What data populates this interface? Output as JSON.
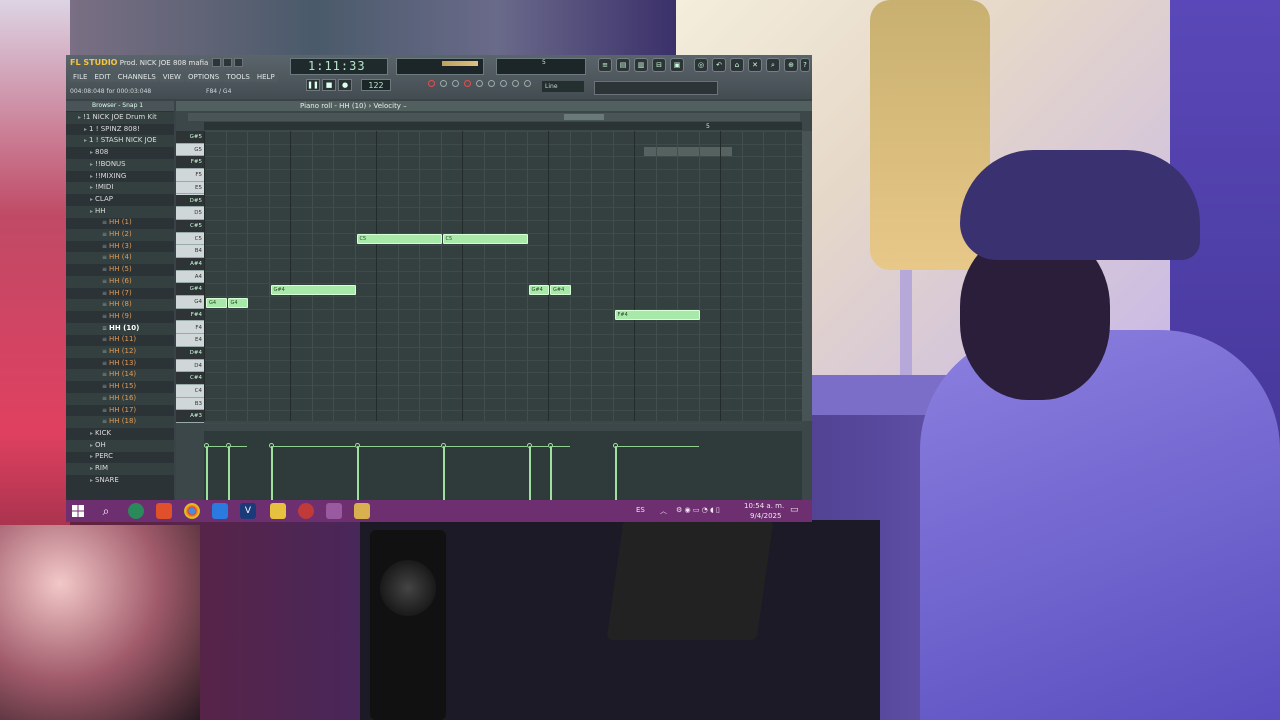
{
  "fl": {
    "title": "Prod. NICK JOE  808 mafia Beat..",
    "logo": "FL STUDIO",
    "menu": [
      "FILE",
      "EDIT",
      "CHANNELS",
      "VIEW",
      "OPTIONS",
      "TOOLS",
      "HELP"
    ],
    "hint_time": "004:08:048 for 000:03:048",
    "hint_right": "F84 / G4",
    "transport_time": "1:11:33",
    "bpm": "122",
    "cpu_label": "5",
    "line_select": "Line",
    "browser_title": "Browser - Snap 1",
    "piano_roll_title": "Piano roll - HH (10) › Velocity –",
    "ruler_number": "5"
  },
  "browser": {
    "items": [
      {
        "label": "!1 NICK JOE Drum Kit",
        "type": "folder"
      },
      {
        "label": "1 ! SPINZ 808!",
        "type": "folder"
      },
      {
        "label": "1 ! STASH NICK JOE",
        "type": "folder"
      },
      {
        "label": "808",
        "type": "folder"
      },
      {
        "label": "!!BONUS",
        "type": "folder"
      },
      {
        "label": "!!MIXING",
        "type": "folder"
      },
      {
        "label": "!MIDI",
        "type": "folder"
      },
      {
        "label": "CLAP",
        "type": "folder"
      },
      {
        "label": "HH",
        "type": "folder"
      },
      {
        "label": "HH (1)",
        "type": "sample"
      },
      {
        "label": "HH (2)",
        "type": "sample"
      },
      {
        "label": "HH (3)",
        "type": "sample"
      },
      {
        "label": "HH (4)",
        "type": "sample"
      },
      {
        "label": "HH (5)",
        "type": "sample"
      },
      {
        "label": "HH (6)",
        "type": "sample"
      },
      {
        "label": "HH (7)",
        "type": "sample"
      },
      {
        "label": "HH (8)",
        "type": "sample"
      },
      {
        "label": "HH (9)",
        "type": "sample"
      },
      {
        "label": "HH (10)",
        "type": "selected"
      },
      {
        "label": "HH (11)",
        "type": "sample"
      },
      {
        "label": "HH (12)",
        "type": "sample"
      },
      {
        "label": "HH (13)",
        "type": "sample"
      },
      {
        "label": "HH (14)",
        "type": "sample"
      },
      {
        "label": "HH (15)",
        "type": "sample"
      },
      {
        "label": "HH (16)",
        "type": "sample"
      },
      {
        "label": "HH (17)",
        "type": "sample"
      },
      {
        "label": "HH (18)",
        "type": "sample"
      },
      {
        "label": "KICK",
        "type": "folder"
      },
      {
        "label": "OH",
        "type": "folder"
      },
      {
        "label": "PERC",
        "type": "folder"
      },
      {
        "label": "RIM",
        "type": "folder"
      },
      {
        "label": "SNARE",
        "type": "folder"
      }
    ]
  },
  "piano_keys": [
    "G#5",
    "G5",
    "F#5",
    "F5",
    "E5",
    "D#5",
    "D5",
    "C#5",
    "C5",
    "B4",
    "A#4",
    "A4",
    "G#4",
    "G4",
    "F#4",
    "F4",
    "E4",
    "D#4",
    "D4",
    "C#4",
    "C4",
    "B3",
    "A#3"
  ],
  "notes": [
    {
      "label": "C5",
      "key": "C5",
      "start": 7,
      "len": 4
    },
    {
      "label": "C5",
      "key": "C5",
      "start": 11,
      "len": 4
    },
    {
      "label": "G#4",
      "key": "G#4",
      "start": 3,
      "len": 4
    },
    {
      "label": "G#4",
      "key": "G#4",
      "start": 15,
      "len": 1
    },
    {
      "label": "G#4",
      "key": "G#4",
      "start": 16,
      "len": 1
    },
    {
      "label": "G4",
      "key": "G4",
      "start": 0,
      "len": 1
    },
    {
      "label": "G4",
      "key": "G4",
      "start": 1,
      "len": 1
    },
    {
      "label": "F#4",
      "key": "F#4",
      "start": 19,
      "len": 4
    }
  ],
  "velocity": [
    0.9,
    0.9,
    0.9,
    0.9,
    0.9,
    0.9,
    0.9,
    0.9
  ],
  "taskbar": {
    "lang": "ES",
    "time": "10:54 a. m.",
    "date": "9/4/2025"
  },
  "colors": {
    "note": "#a8e8a8",
    "taskbar": "#6d2f70",
    "fl_bg": "#3a4347"
  }
}
